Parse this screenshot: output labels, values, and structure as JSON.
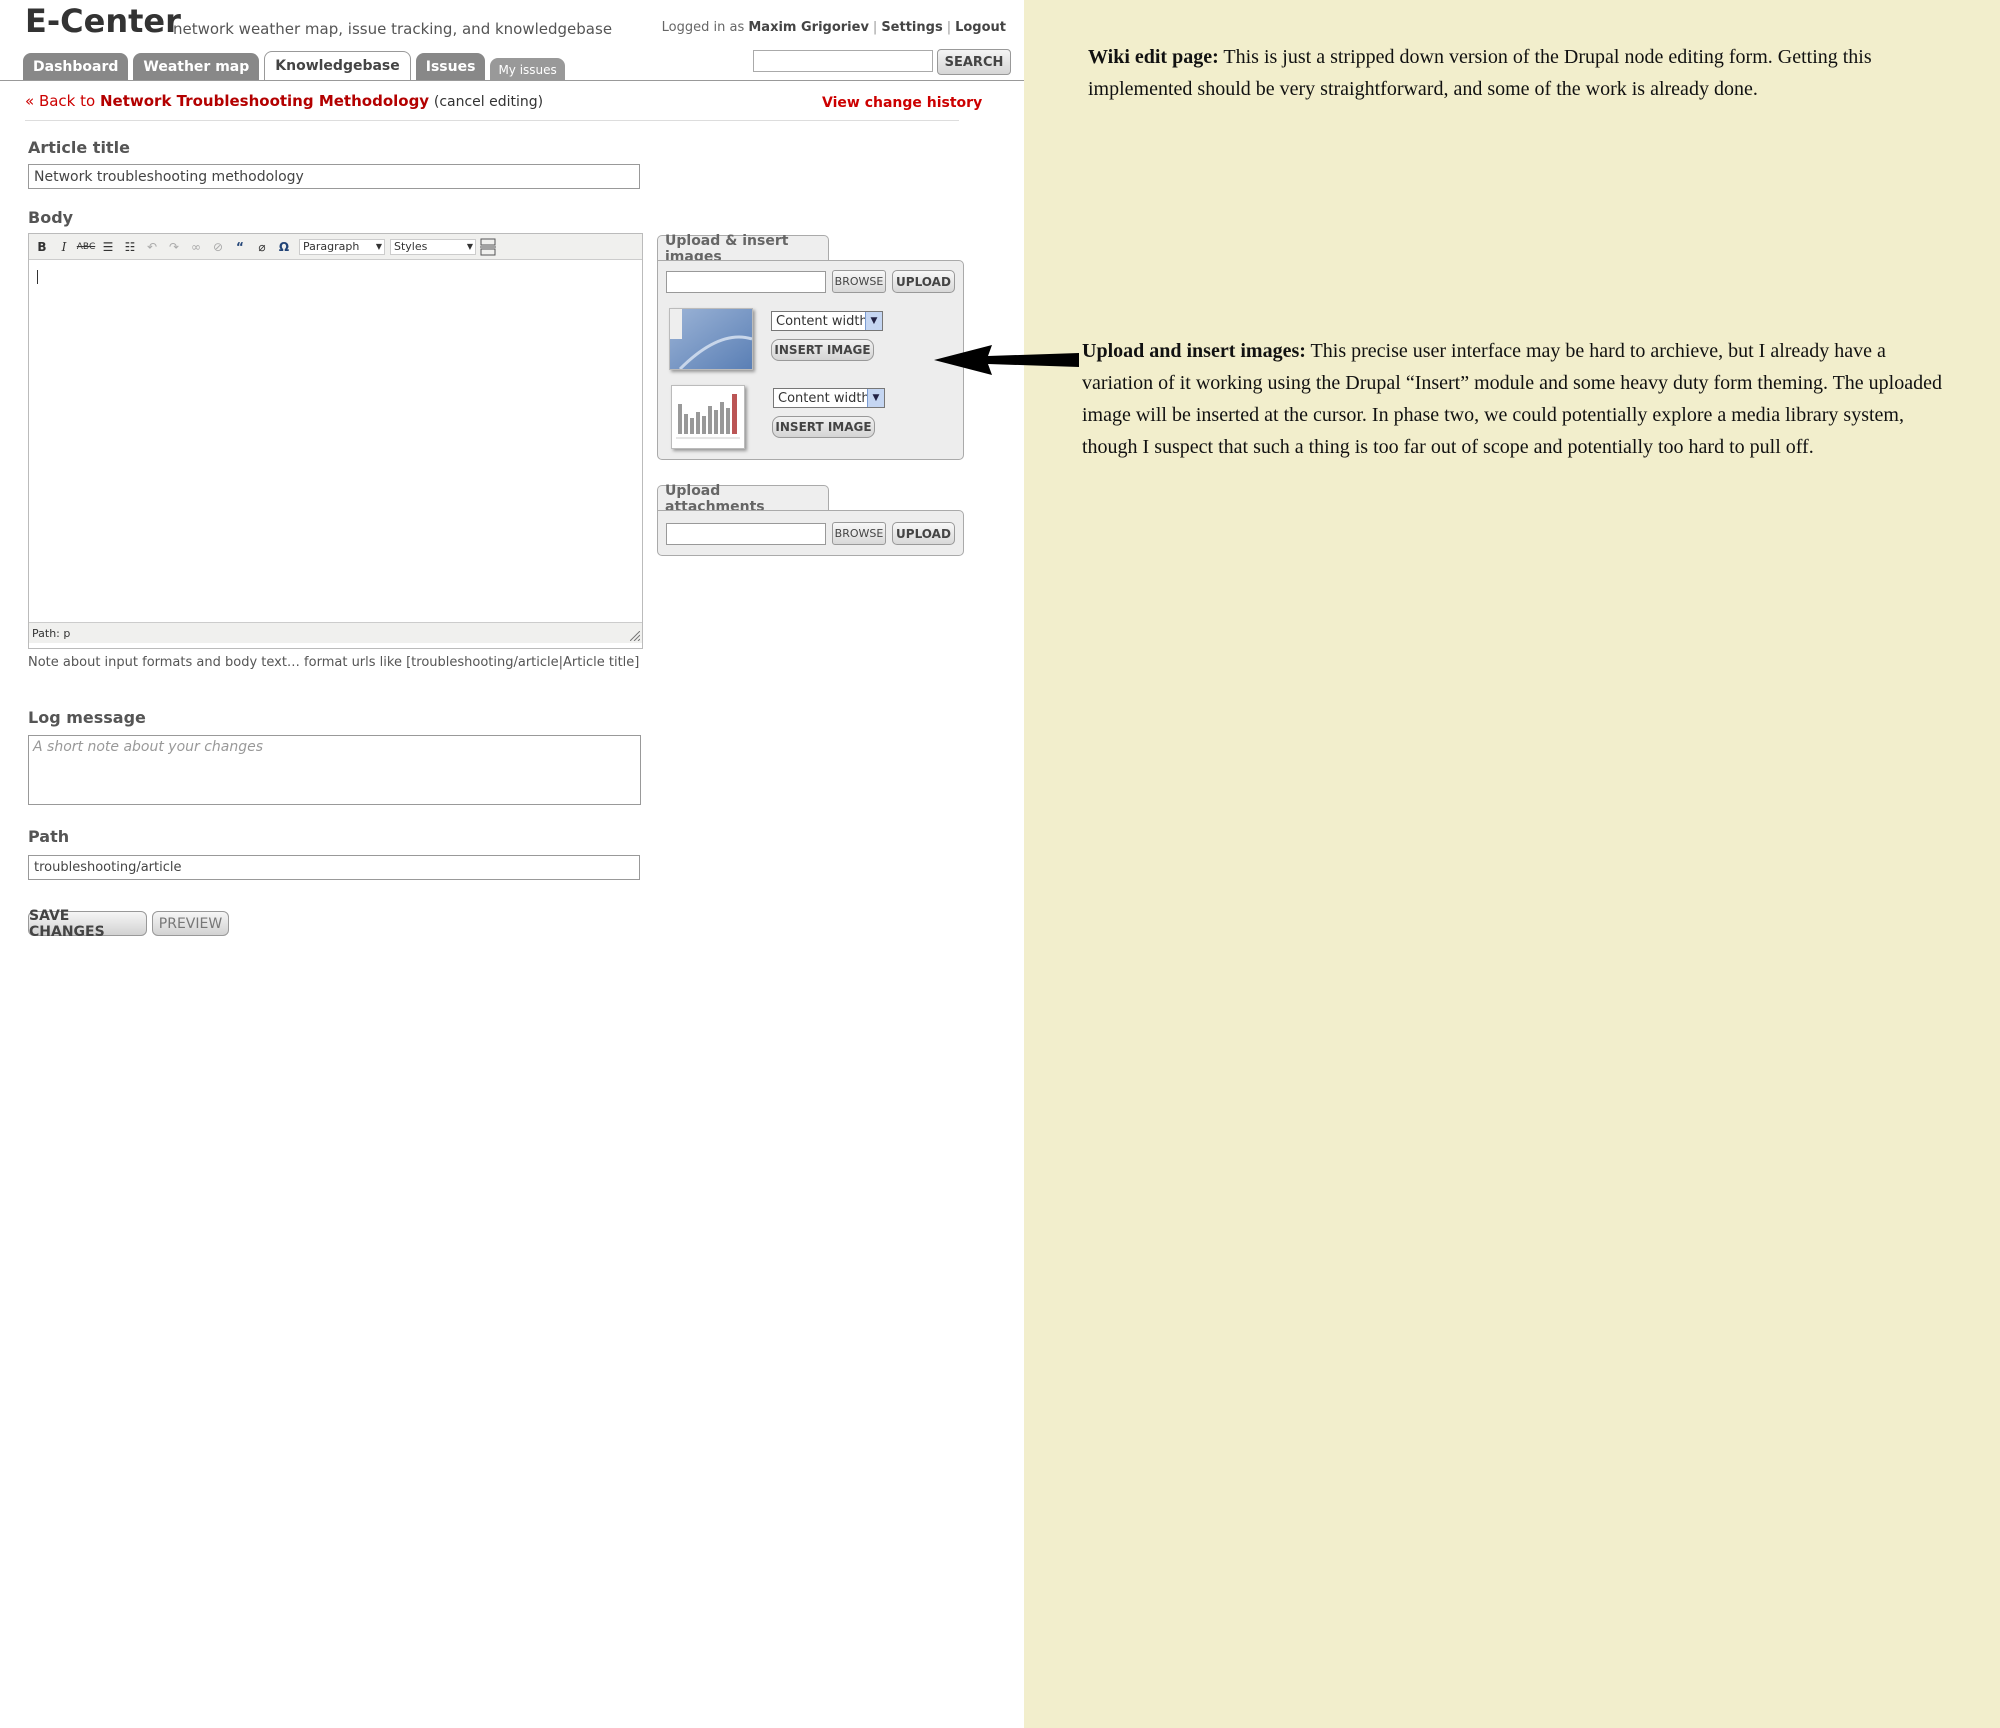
{
  "app": {
    "brand": "E-Center",
    "tagline": "network weather map, issue tracking, and knowledgebase",
    "user": {
      "prefix": "Logged in as",
      "name": "Maxim Grigoriev",
      "settings": "Settings",
      "logout": "Logout"
    },
    "tabs": [
      "Dashboard",
      "Weather map",
      "Knowledgebase",
      "Issues",
      "My issues"
    ],
    "active_tab": "Knowledgebase",
    "search_button": "SEARCH"
  },
  "breadcrumb": {
    "back_prefix": "« Back to",
    "article": "Network Troubleshooting Methodology",
    "cancel": "(cancel editing)",
    "history": "View change history"
  },
  "form": {
    "title_label": "Article title",
    "title_value": "Network troubleshooting methodology",
    "body_label": "Body",
    "format_select": "Paragraph",
    "styles_select": "Styles",
    "editor_path": "Path: p",
    "body_note": "Note about input formats and body text… format urls like [troubleshooting/article|Article title]",
    "log_label": "Log message",
    "log_placeholder": "A short note about your changes",
    "path_label": "Path",
    "path_value": "troubleshooting/article",
    "save": "SAVE CHANGES",
    "preview": "PREVIEW"
  },
  "toolbar_icons": [
    "bold-icon",
    "italic-icon",
    "strikethrough-icon",
    "bullet-list-icon",
    "numbered-list-icon",
    "undo-icon",
    "redo-icon",
    "link-icon",
    "unlink-icon",
    "blockquote-icon",
    "remove-format-icon",
    "special-char-icon",
    "page-break-icon"
  ],
  "images_panel": {
    "title": "Upload & insert images",
    "browse": "BROWSE",
    "upload": "UPLOAD",
    "items": [
      {
        "size": "Content width",
        "insert": "INSERT IMAGE"
      },
      {
        "size": "Content width",
        "insert": "INSERT IMAGE"
      }
    ]
  },
  "attachments_panel": {
    "title": "Upload attachments",
    "browse": "BROWSE",
    "upload": "UPLOAD"
  },
  "notes": [
    {
      "heading": "Wiki edit page:",
      "text": "This is just a stripped down version of the Drupal node editing form.  Getting this implemented should be very straightforward, and some of the work is already done."
    },
    {
      "heading": "Upload and insert images:",
      "text": "This precise user interface may be hard to archieve, but I already have a variation of it working using the Drupal “Insert” module and some heavy duty form theming.  The uploaded image will be inserted at the cursor.  In phase two, we could potentially explore a media library system, though I suspect that such a thing is too far out of scope and potentially too hard to pull off."
    }
  ],
  "colors": {
    "notes_bg": "#f2eecc",
    "link_red": "#cc0000",
    "tab_grey": "#888888"
  }
}
